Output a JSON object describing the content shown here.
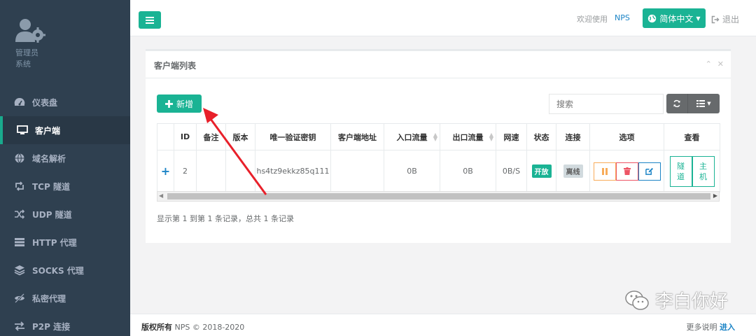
{
  "sidebar": {
    "profile_name": "管理员",
    "profile_role": "系统",
    "items": [
      {
        "label": "仪表盘",
        "icon": "dashboard-icon"
      },
      {
        "label": "客户端",
        "icon": "monitor-icon",
        "active": true
      },
      {
        "label": "域名解析",
        "icon": "globe-icon"
      },
      {
        "label": "TCP 隧道",
        "icon": "retweet-icon"
      },
      {
        "label": "UDP 隧道",
        "icon": "random-icon"
      },
      {
        "label": "HTTP 代理",
        "icon": "server-icon"
      },
      {
        "label": "SOCKS 代理",
        "icon": "layers-icon"
      },
      {
        "label": "私密代理",
        "icon": "eye-slash-icon"
      },
      {
        "label": "P2P 连接",
        "icon": "exchange-icon"
      }
    ]
  },
  "topbar": {
    "welcome": "欢迎使用",
    "user": "NPS",
    "language": "简体中文",
    "logout": "退出"
  },
  "panel": {
    "title": "客户端列表",
    "add_label": "新增",
    "search_placeholder": "搜索",
    "columns": [
      "",
      "ID",
      "备注",
      "版本",
      "唯一验证密钥",
      "客户端地址",
      "入口流量",
      "出口流量",
      "网速",
      "状态",
      "连接",
      "选项",
      "查看"
    ],
    "rows": [
      {
        "id": "2",
        "remark": "",
        "version": "",
        "vkey": "hs4tz9ekkz85q111",
        "address": "",
        "inlet_flow": "0B",
        "export_flow": "0B",
        "speed": "0B/S",
        "status": "开放",
        "connection": "离线",
        "view_tunnel": "隧道",
        "view_host": "主机"
      }
    ],
    "pagination": "显示第 1 到第 1 条记录，总共 1 条记录"
  },
  "footer": {
    "copyright_label": "版权所有",
    "copyright_text": "NPS © 2018-2020",
    "more_label": "更多说明",
    "more_link": "进入"
  },
  "watermark": "李白你好",
  "colors": {
    "sidebar": "#2f4050",
    "primary": "#1ab394",
    "link": "#1c84c6",
    "warning": "#f8ac59",
    "danger": "#ed5565",
    "arrow": "#e8202a"
  }
}
